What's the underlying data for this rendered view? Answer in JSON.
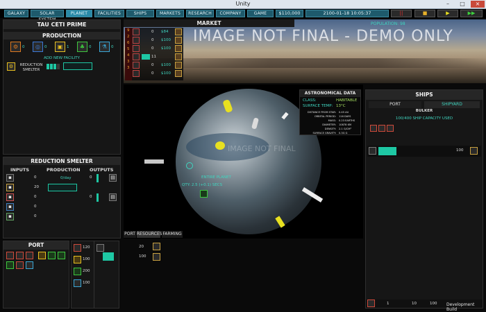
{
  "window": {
    "title": "Unity",
    "close_glyph": "×",
    "min_glyph": "–",
    "max_glyph": "□"
  },
  "nav": {
    "items": [
      "GALAXY",
      "SOLAR SYSTEM",
      "PLANET",
      "FACILITIES",
      "SHIPS",
      "MARKETS",
      "RESEARCH",
      "COMPANY",
      "GAME"
    ],
    "money": "$110,000",
    "date": "2100-01-18 10:05:37"
  },
  "controls": {
    "stop": "||",
    "play": "▶",
    "ff": "▶▶"
  },
  "planet_name": "TAU CETI PRIME",
  "production": {
    "title": "PRODUCTION",
    "facility_counts": [
      "0",
      "0",
      "1",
      "0",
      "0"
    ],
    "add_label": "ADD NEW FACILITY",
    "facility_name": "REDUCTION SMELTER"
  },
  "smelter": {
    "title": "REDUCTION SMELTER",
    "inputs_label": "INPUTS",
    "production_label": "PRODUCTION",
    "outputs_label": "OUTPUTS",
    "rate": "0/day",
    "input_values": [
      "0",
      "20",
      "0",
      "0",
      "0"
    ],
    "output_values": [
      "0",
      "0"
    ]
  },
  "market": {
    "title": "MARKET",
    "rows": [
      {
        "qty": "0",
        "price": "$84"
      },
      {
        "qty": "0",
        "price": "$100"
      },
      {
        "qty": "0",
        "price": "$100"
      },
      {
        "qty": "11",
        "price": ""
      },
      {
        "qty": "0",
        "price": "$100"
      },
      {
        "qty": "0",
        "price": "$100"
      }
    ],
    "row_numbers": [
      "0",
      "9",
      "2",
      "6",
      "5",
      "4",
      "3",
      "3"
    ],
    "banner_text": "IMAGE NOT FINAL - DEMO ONLY",
    "population": "POPULATION: 98"
  },
  "astro": {
    "title": "ASTRONOMICAL DATA",
    "class_label": "CLASS:",
    "class_value": "HABITABLE",
    "temp_label": "SURFACE TEMP:",
    "temp_value": "13°C",
    "stats": [
      {
        "k": "DISTANCE FROM STAR:",
        "v": "0.45 AU"
      },
      {
        "k": "ORBITAL PERIOD:",
        "v": "116 DAYS"
      },
      {
        "k": "MASS:",
        "v": "0.23 EARTHS"
      },
      {
        "k": "DIAMETER:",
        "v": "10878 KM"
      },
      {
        "k": "DENSITY:",
        "v": "2.1 G/CM³"
      },
      {
        "k": "SURFACE GRAVITY:",
        "v": "0.3G G"
      }
    ]
  },
  "globe": {
    "overlay_text": "IMAGE NOT FINAL",
    "caption1": "ENTIRE PLANET",
    "caption2": "QTY: 2.5 (+0.1) SECS"
  },
  "view_tabs": [
    "PORT",
    "RESOURCES",
    "FARMING"
  ],
  "port": {
    "title": "PORT",
    "stock": [
      {
        "qty": "120"
      },
      {
        "qty": "100"
      },
      {
        "qty": "200"
      },
      {
        "qty": "100"
      }
    ],
    "cargo": [
      {
        "qty": "20"
      },
      {
        "qty": "100"
      }
    ]
  },
  "ships": {
    "title": "SHIPS",
    "tabs": [
      "PORT",
      "SHIPYARD"
    ],
    "ship_name": "BULKER",
    "capacity": "100/400 SHIP CAPACITY USED",
    "cargo_qty": "100",
    "footer": [
      "1",
      "10",
      "100"
    ]
  },
  "dev_build": "Development Build"
}
